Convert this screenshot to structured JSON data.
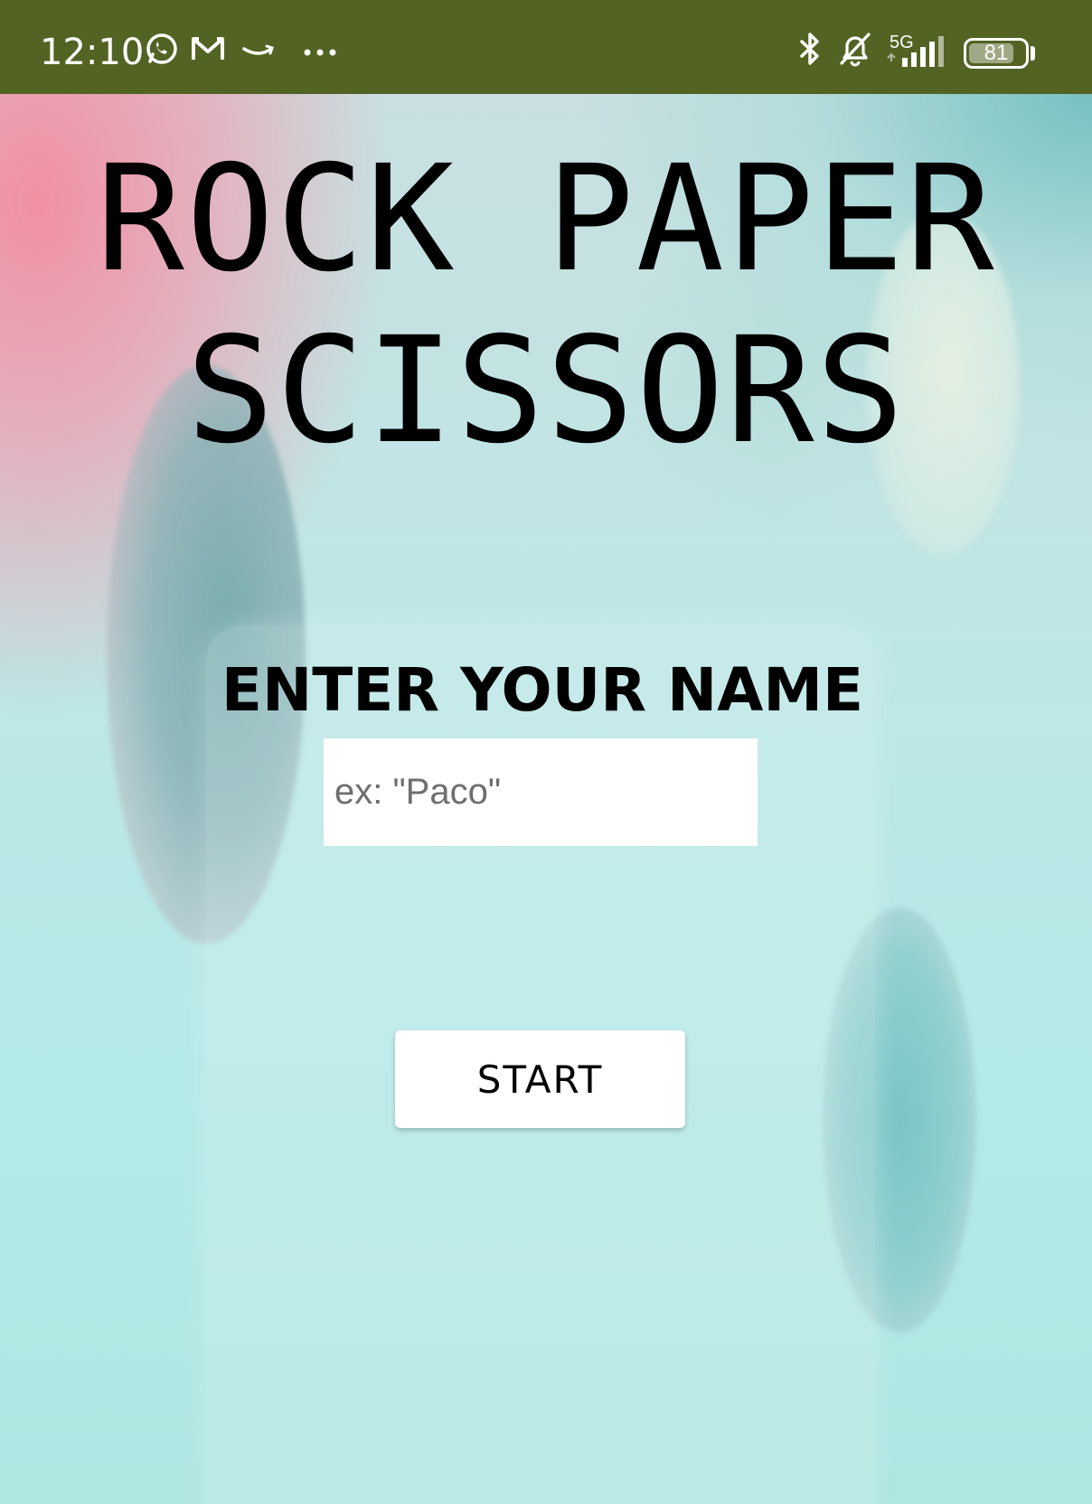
{
  "status_bar": {
    "time": "12:10",
    "network_label": "5G",
    "battery_level": "81",
    "notification_icons": [
      "whatsapp-icon",
      "gmail-icon",
      "amazon-icon",
      "more-dots-icon"
    ],
    "system_icons": [
      "bluetooth-icon",
      "muted-bell-icon",
      "signal-icon",
      "battery-icon"
    ],
    "background_color": "#526324"
  },
  "app": {
    "title_line_1": "ROCK PAPER",
    "title_line_2": "SCISSORS",
    "name_heading": "ENTER YOUR NAME",
    "name_input": {
      "value": "",
      "placeholder": "ex: \"Paco\""
    },
    "start_button_label": "START"
  },
  "colors": {
    "accent_pink": "#f38ca0",
    "accent_teal": "#b4eae8",
    "text": "#000000",
    "button_bg": "#ffffff"
  }
}
